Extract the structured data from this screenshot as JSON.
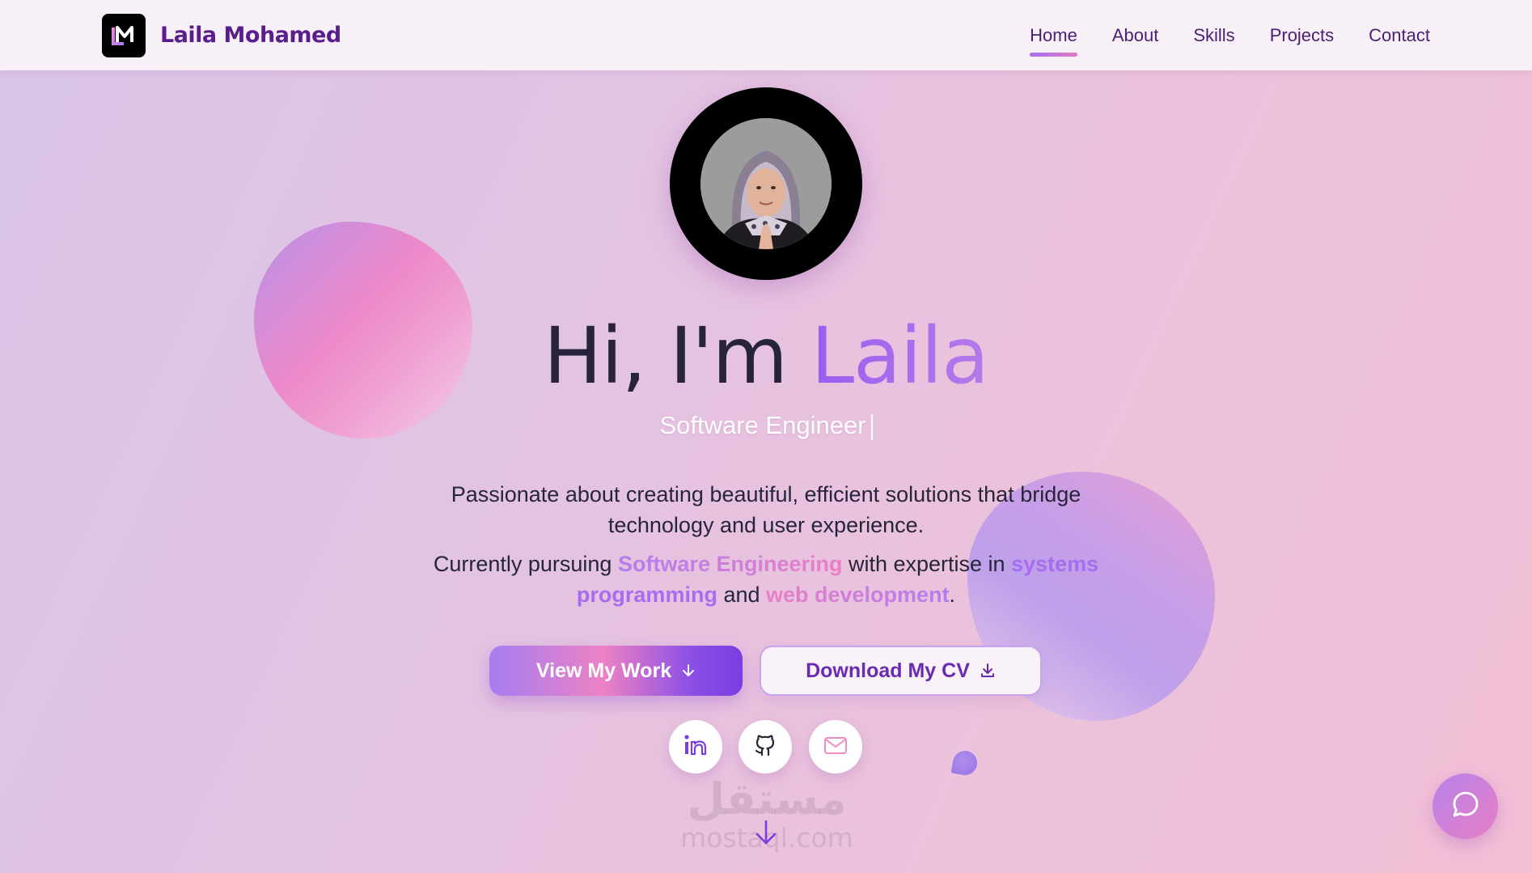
{
  "brand": {
    "name": "Laila Mohamed",
    "logo_icon": "lm-monogram-icon"
  },
  "nav": {
    "items": [
      {
        "label": "Home",
        "active": true
      },
      {
        "label": "About",
        "active": false
      },
      {
        "label": "Skills",
        "active": false
      },
      {
        "label": "Projects",
        "active": false
      },
      {
        "label": "Contact",
        "active": false
      }
    ]
  },
  "hero": {
    "greeting": "Hi, I'm ",
    "name": "Laila",
    "typed_role": "Software Engineer",
    "description_line": "Passionate about creating beautiful, efficient solutions that bridge technology and user experience.",
    "pursuit": {
      "prefix": "Currently pursuing ",
      "field": "Software Engineering",
      "middle": " with expertise in ",
      "skill_1": "systems programming",
      "conjunction": " and ",
      "skill_2": "web development",
      "suffix": "."
    }
  },
  "buttons": {
    "primary_label": "View My Work",
    "primary_icon": "arrow-down-icon",
    "secondary_label": "Download My CV",
    "secondary_icon": "download-icon"
  },
  "socials": [
    {
      "icon": "linkedin-icon"
    },
    {
      "icon": "github-icon"
    },
    {
      "icon": "mail-icon"
    }
  ],
  "watermark": {
    "arabic": "مستقل",
    "latin": "mostaql.com"
  },
  "colors": {
    "accent_purple": "#a56ef0",
    "accent_pink": "#ea7fc5",
    "brand_text": "#5a1e8c"
  }
}
